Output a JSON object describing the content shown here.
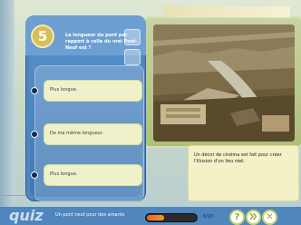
{
  "question": {
    "number": "5",
    "text": "La longueur du pont par rapport à celle du vrai Pont-Neuf est ?"
  },
  "answers": [
    {
      "label": "Plus longue."
    },
    {
      "label": "De ma même longueur."
    },
    {
      "label": "Plus longue."
    }
  ],
  "caption": "Un décor de cinéma est fait pour créer l'illusion d'un lieu réel.",
  "footer": {
    "logo": "quiz",
    "title": "Un pont neuf pour des amants",
    "score": "8/20",
    "progress_fraction": 0.35
  },
  "buttons": {
    "help": "?",
    "close": "✕"
  },
  "colors": {
    "panel_blue": "#4f86bd",
    "answer_pill": "#eef1c9",
    "badge_gold": "#d7bf55",
    "progress_orange": "#e8622b"
  }
}
